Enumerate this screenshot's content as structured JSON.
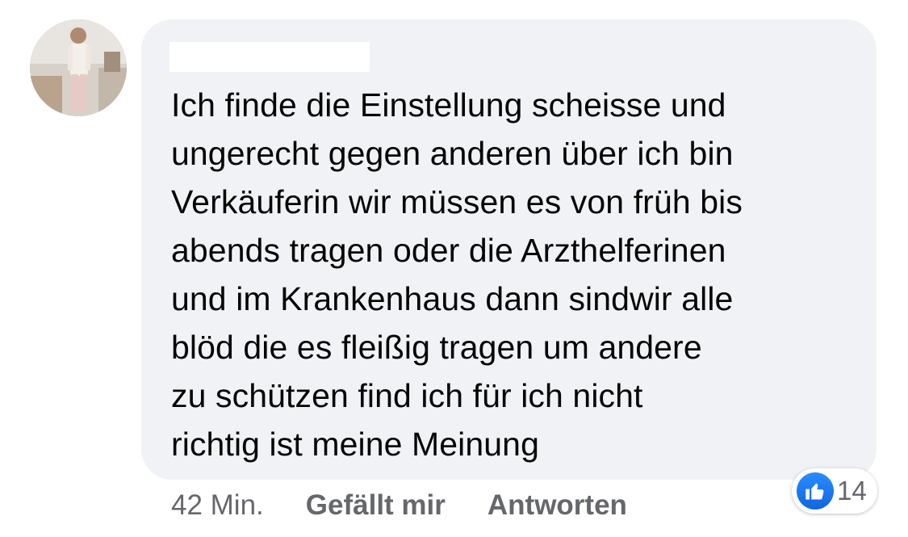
{
  "comment": {
    "lines": [
      "Ich finde die Einstellung scheisse und",
      "ungerecht gegen anderen über ich bin",
      "Verkäuferin wir müssen es von früh bis",
      "abends tragen oder die Arzthelferinen",
      "und im Krankenhaus dann sindwir alle",
      "blöd die es fleißig tragen um andere",
      "zu schützen find ich für ich nicht",
      "richtig ist meine Meinung"
    ]
  },
  "meta": {
    "time": "42 Min.",
    "like_label": "Gefällt mir",
    "reply_label": "Antworten"
  },
  "reactions": {
    "icon": "thumbs-up-icon",
    "count": "14",
    "color": "#1877f2"
  }
}
